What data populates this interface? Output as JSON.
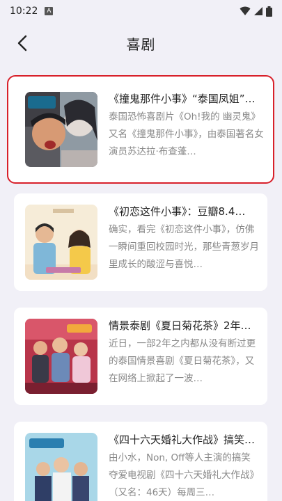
{
  "status": {
    "time": "10:22",
    "notif_glyph": "A"
  },
  "header": {
    "title": "喜剧"
  },
  "articles": [
    {
      "title": "《撞鬼那件小事》“泰国凤姐”…",
      "desc": "泰国恐怖喜剧片《Oh!我的 幽灵鬼》又名《撞鬼那件小事》，由泰国著名女演员苏达拉·布查蓬…",
      "selected": true
    },
    {
      "title": "《初恋这件小事》：豆瓣8.4…",
      "desc": "确实，看完《初恋这件小事》，仿佛一瞬间重回校园时光，那些青葱岁月里成长的酸涩与喜悦…",
      "selected": false
    },
    {
      "title": "情景泰剧《夏日菊花茶》2年…",
      "desc": "近日，一部2年之内都从没有断过更的泰国情景喜剧《夏日菊花茶》，又在网络上掀起了一波…",
      "selected": false
    },
    {
      "title": "《四十六天婚礼大作战》搞笑…",
      "desc": "由小水，Non, Off等人主演的搞笑夺爱电视剧《四十六天婚礼大作战》（又名：46天）每周三…",
      "selected": false
    }
  ]
}
